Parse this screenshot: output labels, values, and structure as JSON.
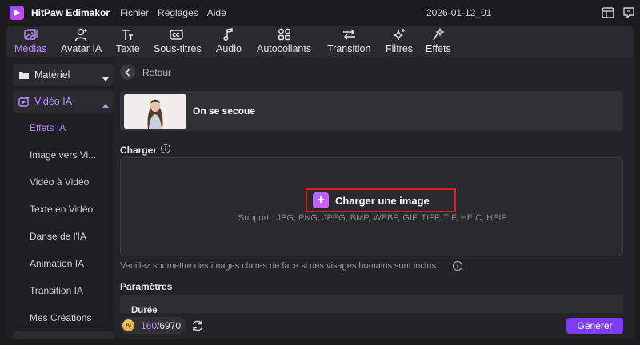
{
  "titlebar": {
    "app_title": "HitPaw Edimakor",
    "menu": [
      "Fichier",
      "Réglages",
      "Aide"
    ],
    "project_name": "2026-01-12_01"
  },
  "toolbar": {
    "tools": [
      {
        "label": "Médias",
        "icon": "media-icon",
        "active": true
      },
      {
        "label": "Avatar IA",
        "icon": "avatar-icon",
        "active": false
      },
      {
        "label": "Texte",
        "icon": "text-icon",
        "active": false
      },
      {
        "label": "Sous-titres",
        "icon": "subtitles-icon",
        "active": false
      },
      {
        "label": "Audio",
        "icon": "music-note-icon",
        "active": false
      },
      {
        "label": "Autocollants",
        "icon": "stickers-icon",
        "active": false
      },
      {
        "label": "Transition",
        "icon": "transition-icon",
        "active": false
      },
      {
        "label": "Filtres",
        "icon": "sparkle-icon",
        "active": false
      },
      {
        "label": "Effets",
        "icon": "effects-icon",
        "active": false
      }
    ]
  },
  "sidebar": {
    "materiel": "Matériel",
    "video_ia": "Vidéo IA",
    "items": [
      {
        "label": "Effets IA",
        "active": true
      },
      {
        "label": "Image vers Vi...",
        "active": false
      },
      {
        "label": "Vidéo à Vidéo",
        "active": false
      },
      {
        "label": "Texte en Vidéo",
        "active": false
      },
      {
        "label": "Danse de l'IA",
        "active": false
      },
      {
        "label": "Animation IA",
        "active": false
      },
      {
        "label": "Transition IA",
        "active": false
      },
      {
        "label": "Mes Créations",
        "active": false
      }
    ]
  },
  "main": {
    "back_label": "Retour",
    "template_name": "On se secoue",
    "upload_section": "Charger",
    "upload_button": "Charger une image",
    "support_text": "Support : JPG, PNG, JPEG, BMP, WEBP, GIF, TIFF, TIF, HEIC, HEIF",
    "hint_text": "Veuillez soumettre des images claires de face si des visages humains sont inclus.",
    "params_section": "Paramètres",
    "duration_label": "Durée"
  },
  "footer": {
    "credits_used": "160",
    "credits_total": "/6970",
    "generate_label": "Générer"
  },
  "colors": {
    "accent": "#b88cff",
    "generate": "#7d3cf0",
    "highlight_border": "#e02020"
  }
}
